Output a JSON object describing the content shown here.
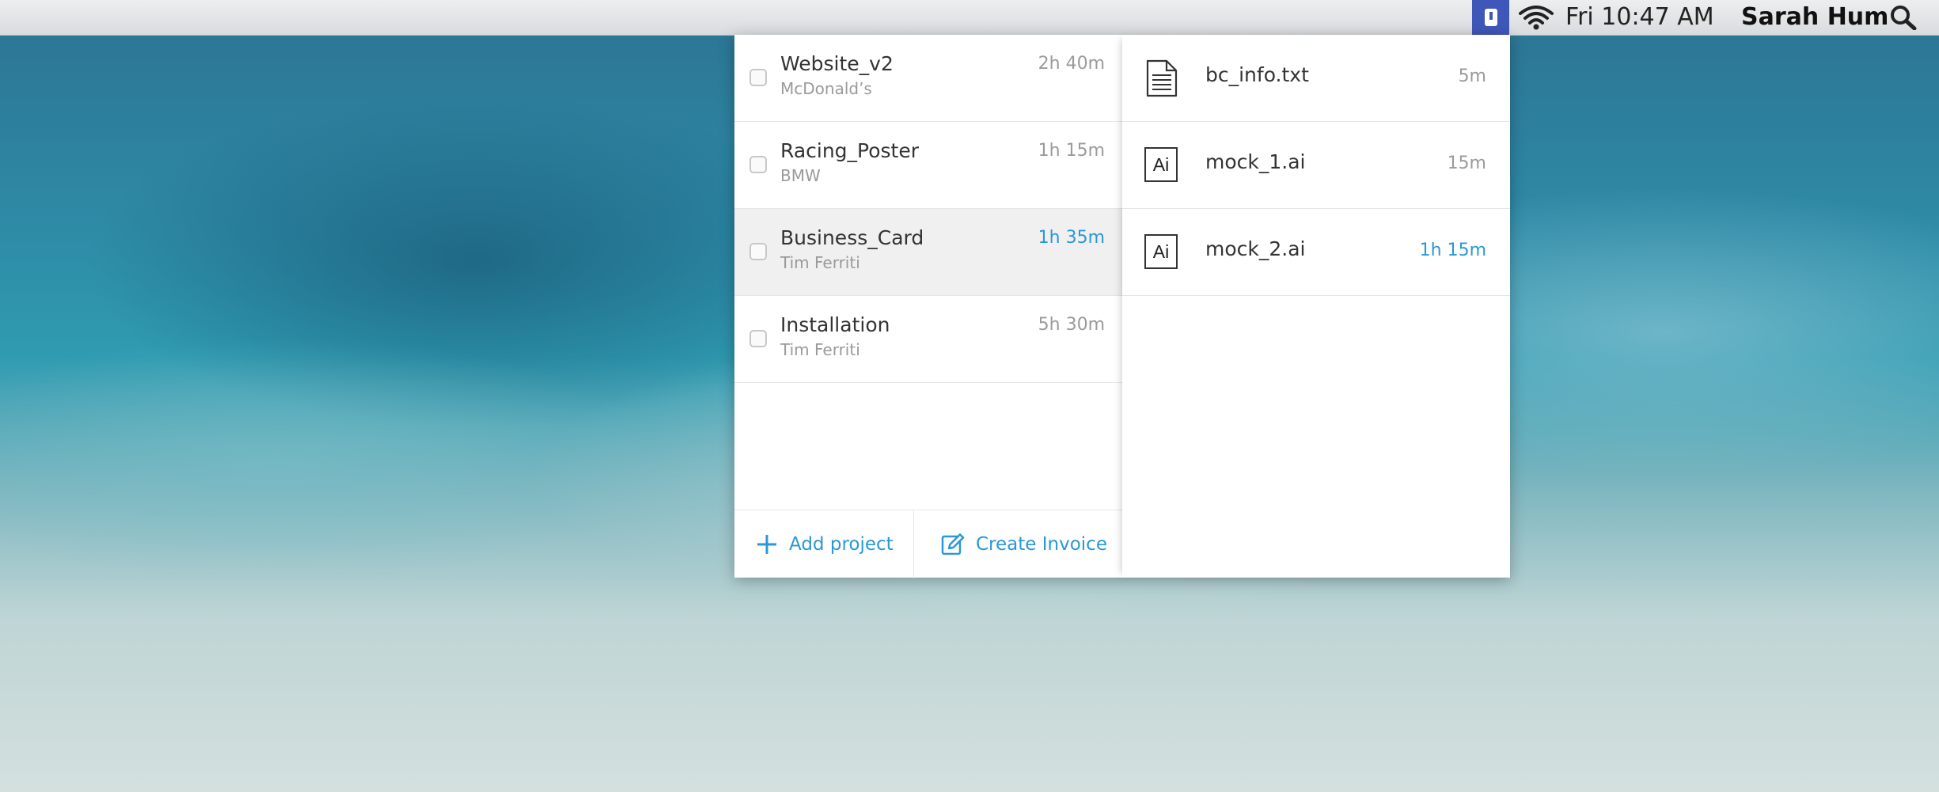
{
  "menubar": {
    "clock": "Fri 10:47 AM",
    "user": "Sarah Hum",
    "icons": [
      "app-icon",
      "wifi-icon",
      "search-icon"
    ],
    "accent": "#3f57b8"
  },
  "projects": {
    "items": [
      {
        "name": "Website_v2",
        "client": "McDonald’s",
        "time": "2h 40m"
      },
      {
        "name": "Racing_Poster",
        "client": "BMW",
        "time": "1h 15m"
      },
      {
        "name": "Business_Card",
        "client": "Tim Ferriti",
        "time": "1h 35m",
        "selected": true
      },
      {
        "name": "Installation",
        "client": "Tim Ferriti",
        "time": "5h 30m"
      }
    ],
    "add_label": "Add project",
    "invoice_label": "Create Invoice"
  },
  "files": {
    "items": [
      {
        "name": "bc_info.txt",
        "time": "5m",
        "icon": "text-file-icon"
      },
      {
        "name": "mock_1.ai",
        "time": "15m",
        "icon": "illustrator-file-icon",
        "badge": "Ai"
      },
      {
        "name": "mock_2.ai",
        "time": "1h 15m",
        "icon": "illustrator-file-icon",
        "badge": "Ai"
      }
    ]
  },
  "colors": {
    "accent": "#2a98d6",
    "muted": "#9a9a9a"
  }
}
